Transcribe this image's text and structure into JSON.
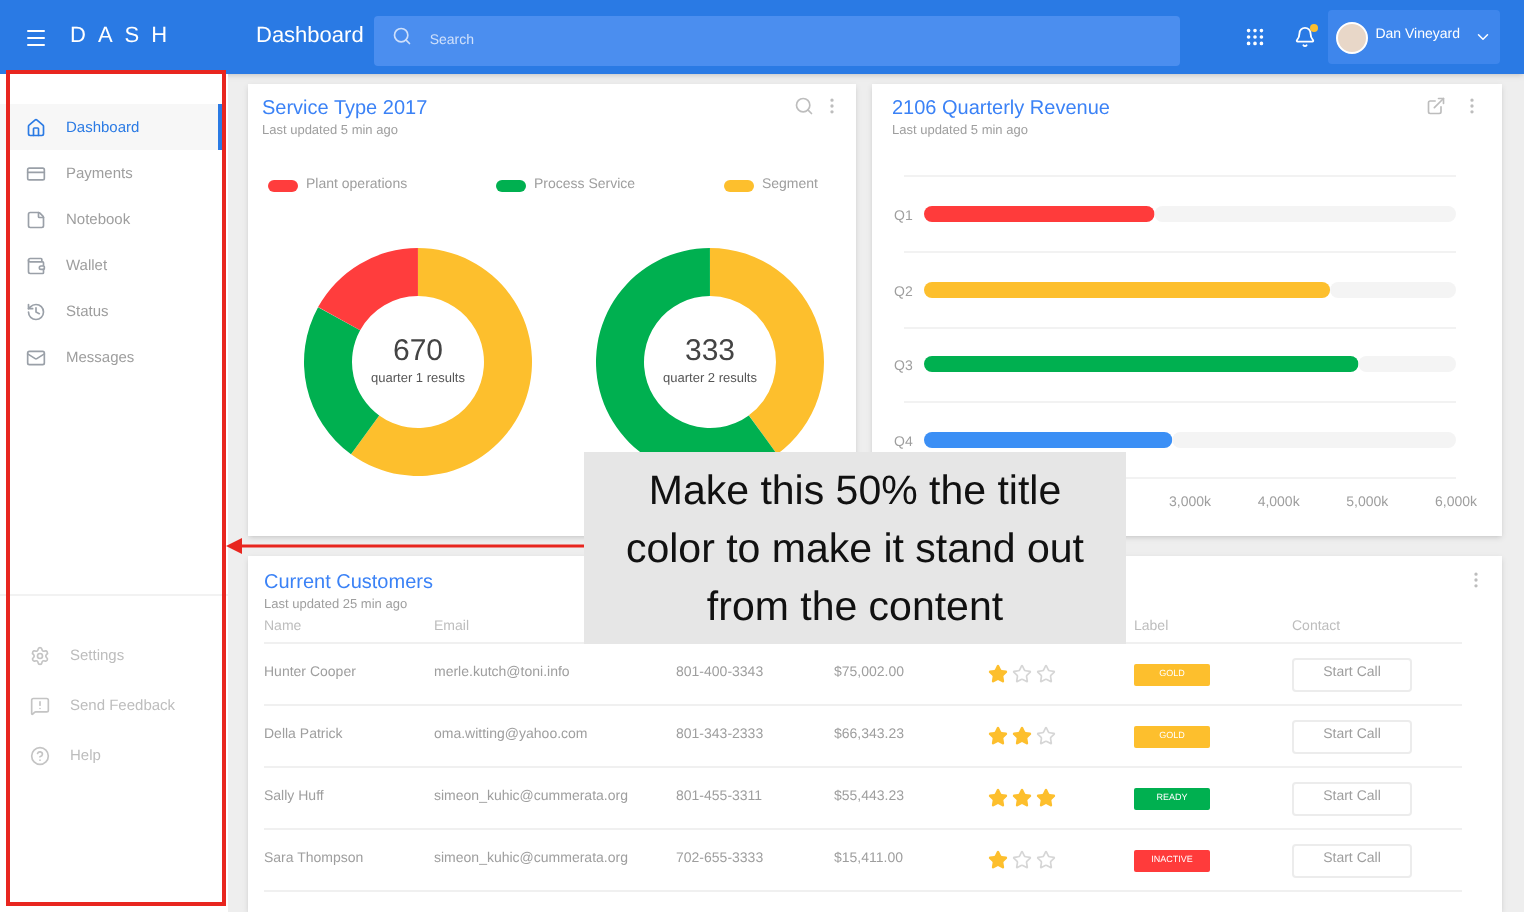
{
  "topbar": {
    "brand": "DASH",
    "title": "Dashboard",
    "search": {
      "placeholder": "Search"
    },
    "notification": true,
    "user": {
      "name": "Dan Vineyard"
    }
  },
  "sidebar": {
    "items": [
      {
        "label": "Dashboard",
        "selected": true
      },
      {
        "label": "Payments",
        "selected": false
      },
      {
        "label": "Notebook",
        "selected": false
      },
      {
        "label": "Wallet",
        "selected": false
      },
      {
        "label": "Status",
        "selected": false
      },
      {
        "label": "Messages",
        "selected": false
      }
    ],
    "footer_items": [
      {
        "label": "Settings"
      },
      {
        "label": "Send Feedback"
      },
      {
        "label": "Help"
      }
    ]
  },
  "service_card": {
    "title": "Service Type 2017",
    "subtitle": "Last updated 5 min ago",
    "legend": [
      {
        "label": "Plant operations",
        "color": "#ff3d3d"
      },
      {
        "label": "Process Service",
        "color": "#00b050"
      },
      {
        "label": "Segment",
        "color": "#fdbf2d"
      }
    ],
    "donuts": [
      {
        "value": "670",
        "caption": "quarter 1 results"
      },
      {
        "value": "333",
        "caption": "quarter 2 results"
      }
    ]
  },
  "revenue_card": {
    "title": "2106 Quarterly Revenue",
    "subtitle": "Last updated 5 min ago",
    "chart_data": {
      "type": "bar",
      "orientation": "horizontal",
      "categories": [
        "Q1",
        "Q2",
        "Q3",
        "Q4"
      ],
      "xlim": [
        0,
        6000
      ],
      "xticks": [
        {
          "value": 3000,
          "label": "3,000k"
        },
        {
          "value": 4000,
          "label": "4,000k"
        },
        {
          "value": 5000,
          "label": "5,000k"
        },
        {
          "value": 6000,
          "label": "6,000k"
        }
      ],
      "stacked": true,
      "series": [
        {
          "color": "#ff3b3b",
          "values": [
            2600,
            null,
            null,
            null
          ]
        },
        {
          "color": "#fdbf2d",
          "values": [
            null,
            4580,
            null,
            null
          ]
        },
        {
          "color": "#00b050",
          "values": [
            null,
            null,
            4900,
            null
          ]
        },
        {
          "color": "#3b8ff5",
          "values": [
            null,
            null,
            null,
            2800
          ]
        },
        {
          "color": "#f4f4f4",
          "values": [
            3400,
            1420,
            1100,
            3200
          ]
        }
      ]
    }
  },
  "customers_card": {
    "title": "Current Customers",
    "subtitle": "Last updated 25 min ago",
    "columns": [
      "Name",
      "Email",
      null,
      null,
      null,
      "Label",
      "Contact"
    ],
    "rows": [
      {
        "name": "Hunter Cooper",
        "email": "merle.kutch@toni.info",
        "phone": "801-400-3343",
        "amount": "$75,002.00",
        "stars": 1,
        "label": {
          "text": "GOLD",
          "color": "#fdbf2d"
        },
        "action": "Start Call"
      },
      {
        "name": "Della Patrick",
        "email": "oma.witting@yahoo.com",
        "phone": "801-343-2333",
        "amount": "$66,343.23",
        "stars": 2,
        "label": {
          "text": "GOLD",
          "color": "#fdbf2d"
        },
        "action": "Start Call"
      },
      {
        "name": "Sally Huff",
        "email": "simeon_kuhic@cummerata.org",
        "phone": "801-455-3311",
        "amount": "$55,443.23",
        "stars": 3,
        "label": {
          "text": "READY",
          "color": "#00b050"
        },
        "action": "Start Call"
      },
      {
        "name": "Sara Thompson",
        "email": "simeon_kuhic@cummerata.org",
        "phone": "702-655-3333",
        "amount": "$15,411.00",
        "stars": 1,
        "label": {
          "text": "INACTIVE",
          "color": "#ff3b3b"
        },
        "action": "Start Call"
      }
    ]
  },
  "annotation": {
    "note": "Make this 50% the title color to make it stand out from the content"
  }
}
